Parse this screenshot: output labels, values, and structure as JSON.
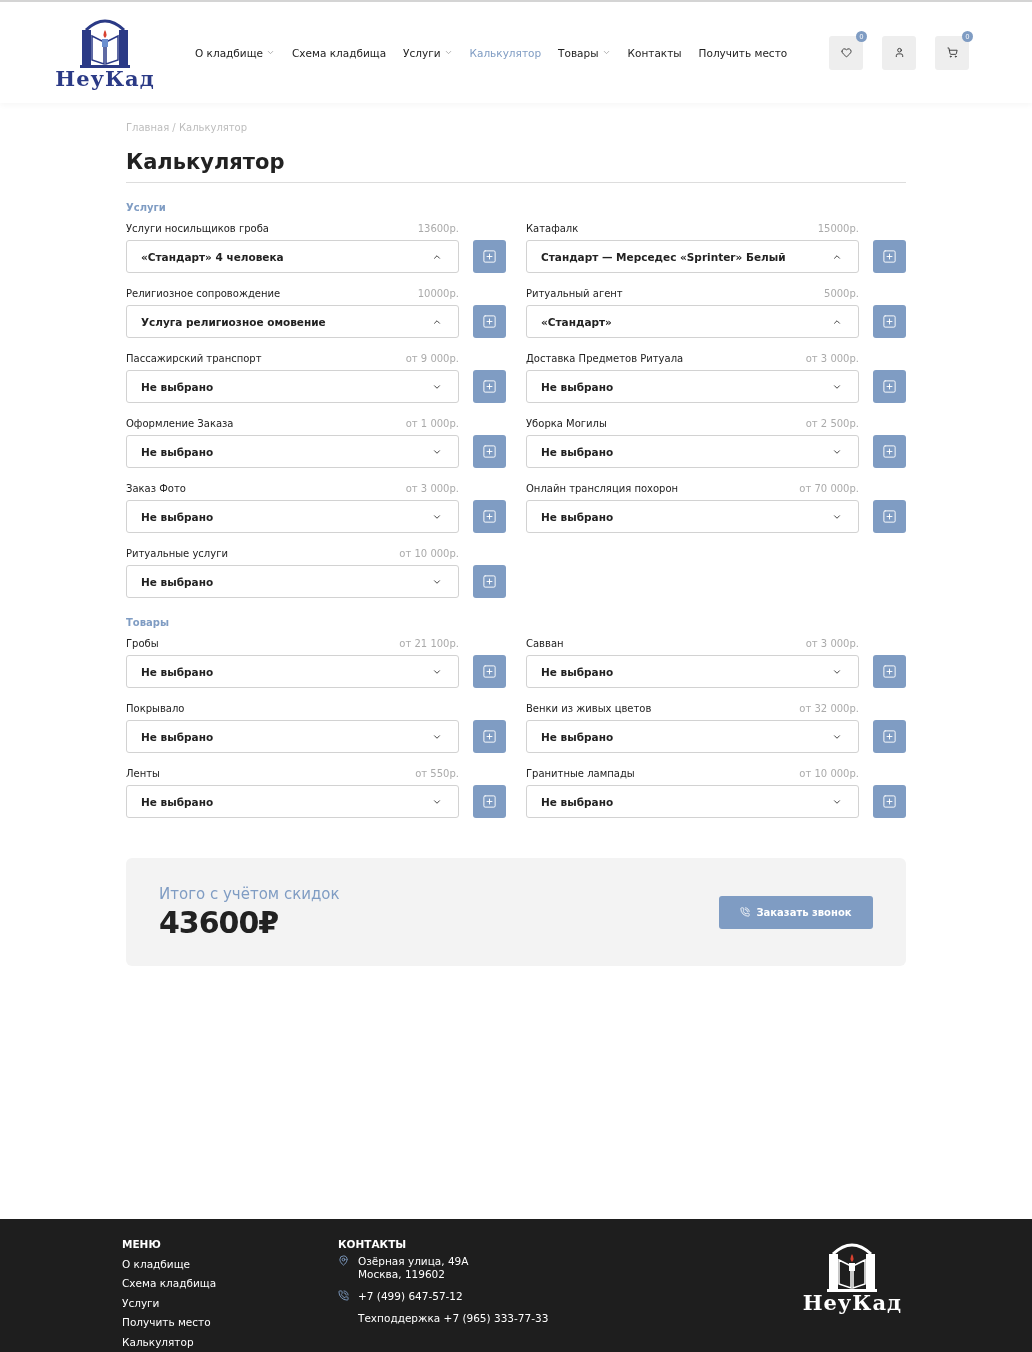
{
  "header": {
    "logo_text": "НеуКад",
    "nav": [
      {
        "label": "О кладбище",
        "dropdown": true,
        "selected": false
      },
      {
        "label": "Схема кладбища",
        "dropdown": false,
        "selected": false
      },
      {
        "label": "Услуги",
        "dropdown": true,
        "selected": false
      },
      {
        "label": "Калькулятор",
        "dropdown": false,
        "selected": true
      },
      {
        "label": "Товары",
        "dropdown": true,
        "selected": false
      },
      {
        "label": "Контакты",
        "dropdown": false,
        "selected": false
      },
      {
        "label": "Получить место",
        "dropdown": false,
        "selected": false
      }
    ],
    "actions": [
      {
        "kind": "favorites",
        "badge": "0"
      },
      {
        "kind": "account"
      },
      {
        "kind": "cart",
        "badge": "0"
      }
    ]
  },
  "breadcrumbs": "Главная / Калькулятор",
  "title": "Калькулятор",
  "sections": [
    {
      "title": "Услуги",
      "fields": [
        {
          "label": "Услуги носильщиков гроба",
          "price": "13600р.",
          "value": "«Стандарт» 4 человека",
          "expanded": true
        },
        {
          "label": "Катафалк",
          "price": "15000р.",
          "value": "Стандарт — Мерседес «Sprinter» Белый",
          "expanded": true
        },
        {
          "label": "Религиозное сопровождение",
          "price": "10000р.",
          "value": "Услуга религиозное омовение",
          "expanded": true
        },
        {
          "label": "Ритуальный агент",
          "price": "5000р.",
          "value": "«Стандарт»",
          "expanded": true
        },
        {
          "label": "Пассажирский транспорт",
          "price": "от 9 000р.",
          "value": "Не выбрано",
          "expanded": false
        },
        {
          "label": "Доставка Предметов Ритуала",
          "price": "от 3 000р.",
          "value": "Не выбрано",
          "expanded": false
        },
        {
          "label": "Оформление Заказа",
          "price": "от 1 000р.",
          "value": "Не выбрано",
          "expanded": false
        },
        {
          "label": "Уборка Могилы",
          "price": "от 2 500р.",
          "value": "Не выбрано",
          "expanded": false
        },
        {
          "label": "Заказ Фото",
          "price": "от 3 000р.",
          "value": "Не выбрано",
          "expanded": false
        },
        {
          "label": "Онлайн трансляция похорон",
          "price": "от 70 000р.",
          "value": "Не выбрано",
          "expanded": false
        },
        {
          "label": "Ритуальные услуги",
          "price": "от 10 000р.",
          "value": "Не выбрано",
          "expanded": false
        }
      ]
    },
    {
      "title": "Товары",
      "fields": [
        {
          "label": "Гробы",
          "price": "от 21 100р.",
          "value": "Не выбрано",
          "expanded": false
        },
        {
          "label": "Савван",
          "price": "от 3 000р.",
          "value": "Не выбрано",
          "expanded": false
        },
        {
          "label": "Покрывало",
          "value": "Не выбрано",
          "expanded": false
        },
        {
          "label": "Венки из живых цветов",
          "price": "от 32 000р.",
          "value": "Не выбрано",
          "expanded": false
        },
        {
          "label": "Ленты",
          "price": "от 550р.",
          "value": "Не выбрано",
          "expanded": false
        },
        {
          "label": "Гранитные лампады",
          "price": "от 10 000р.",
          "value": "Не выбрано",
          "expanded": false
        }
      ]
    }
  ],
  "total": {
    "label": "Итого с учётом скидок",
    "amount": "43600₽",
    "button": "Заказать звонок"
  },
  "footer": {
    "menu_title": "МЕНЮ",
    "menu": [
      "О кладбище",
      "Схема кладбища",
      "Услуги",
      "Получить место",
      "Калькулятор"
    ],
    "contacts_title": "КОНТАКТЫ",
    "contacts": [
      {
        "kind": "address",
        "lines": [
          "Озёрная улица, 49А",
          "Москва, 119602"
        ]
      },
      {
        "kind": "phone",
        "lines": [
          "+7 (499) 647-57-12"
        ]
      },
      {
        "kind": "support",
        "lines": [
          "Техподдержка +7 (965) 333-77-33"
        ]
      }
    ],
    "logo_text": "НеуКад"
  }
}
